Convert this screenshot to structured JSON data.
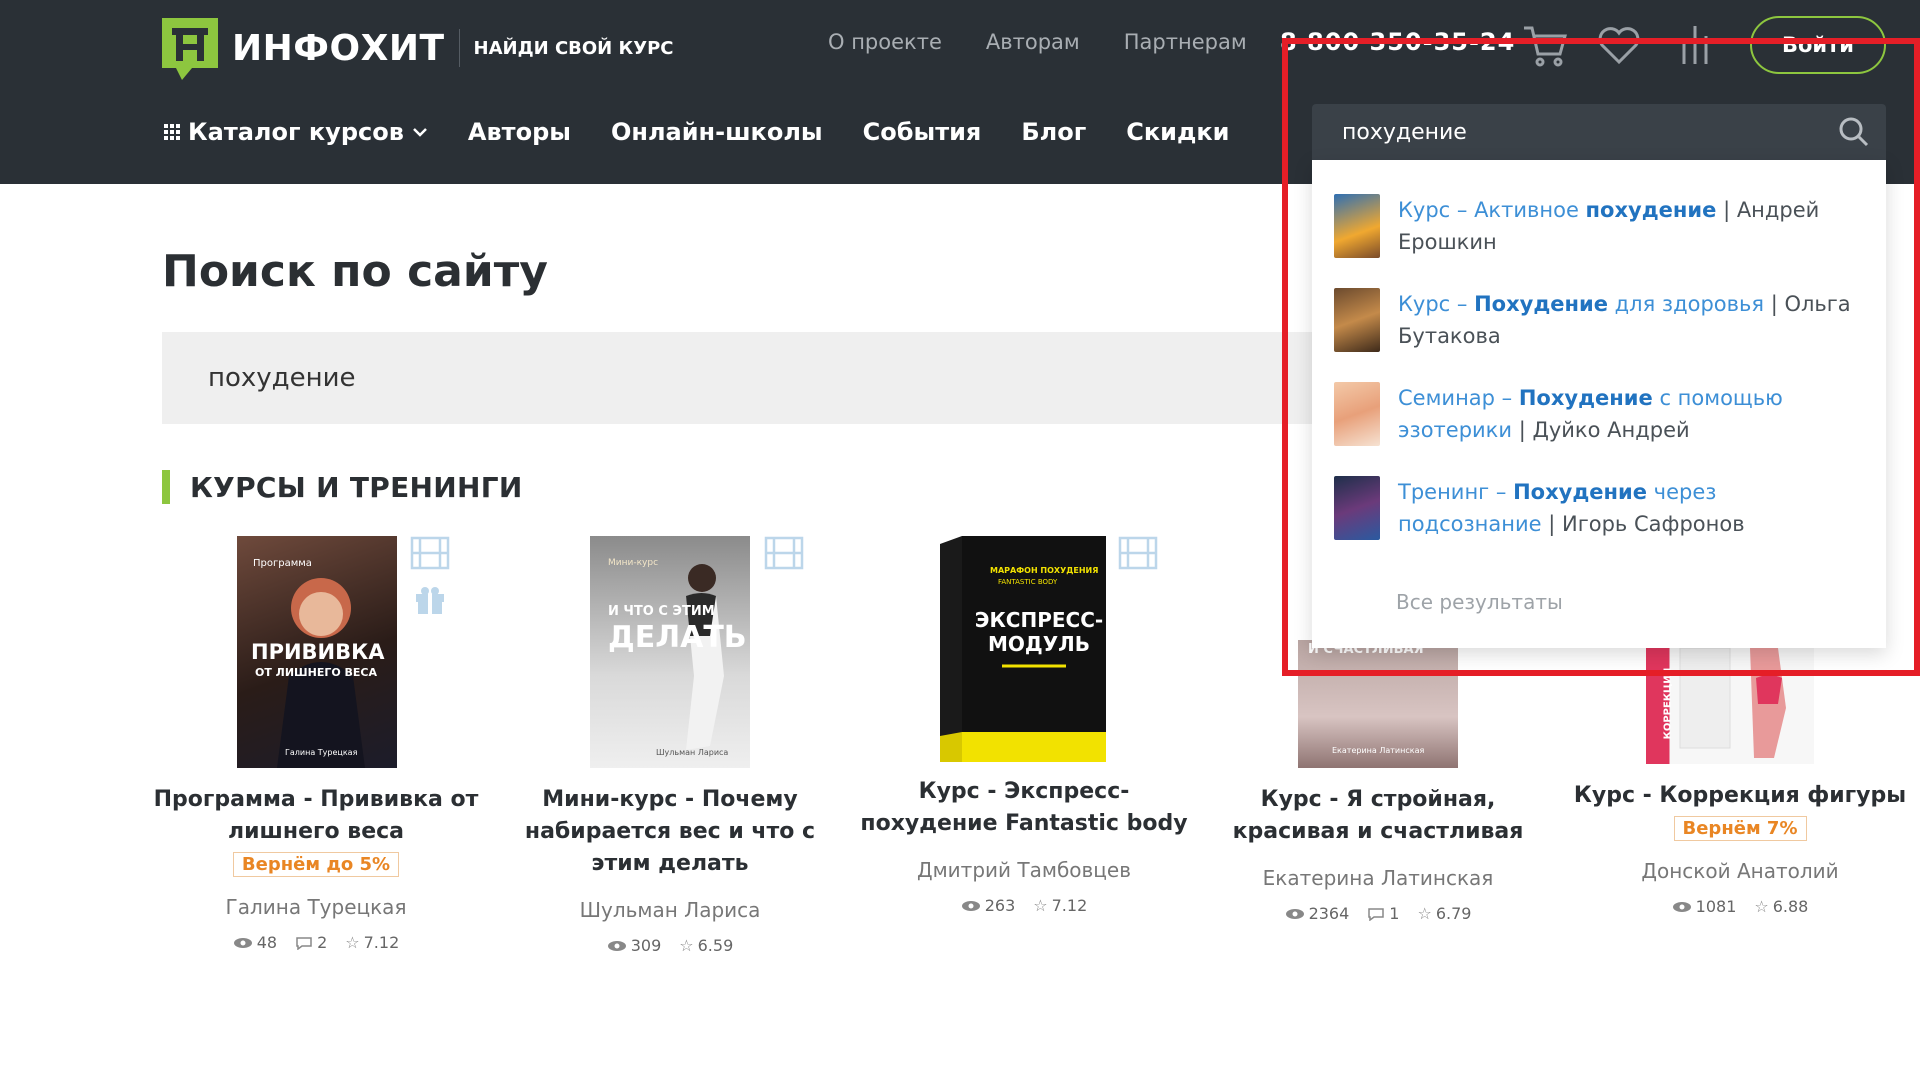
{
  "header": {
    "logo_name": "ИНФОХИТ",
    "logo_tagline": "НАЙДИ СВОЙ КУРС",
    "top_nav": [
      "О проекте",
      "Авторам",
      "Партнерам"
    ],
    "phone": "8 800 350-35-24",
    "login_label": "Войти",
    "main_nav": [
      "Каталог курсов",
      "Авторы",
      "Онлайн-школы",
      "События",
      "Блог",
      "Скидки"
    ]
  },
  "search_overlay": {
    "query": "похудение",
    "suggestions": [
      {
        "link_pre": "Курс – Активное ",
        "link_bold": "похудение",
        "link_post": "",
        "rest": " | Андрей Ерошкин"
      },
      {
        "link_pre": "Курс – ",
        "link_bold": "Похудение",
        "link_post": " для здоровья",
        "rest": " | Ольга Бутакова"
      },
      {
        "link_pre": "Семинар – ",
        "link_bold": "Похудение",
        "link_post": " с помощью эзотерики",
        "rest": " | Дуйко Андрей"
      },
      {
        "link_pre": "Тренинг – ",
        "link_bold": "Похудение",
        "link_post": " через подсознание",
        "rest": " | Игорь Сафронов"
      }
    ],
    "all_results_label": "Все результаты"
  },
  "page": {
    "title": "Поиск по сайту",
    "search_value": "похудение",
    "section_title": "КУРСЫ И ТРЕНИНГИ"
  },
  "cards": [
    {
      "title": "Программа - Прививка от лишнего веса",
      "cashback": "Вернём до 5%",
      "author": "Галина Турецкая",
      "views": "48",
      "comments": "2",
      "rating": "7.12",
      "cover_top": "Программа",
      "cover_main": "ПРИВИВКА",
      "cover_sub": "ОТ ЛИШНЕГО ВЕСА",
      "cover_author": "Галина Турецкая"
    },
    {
      "title": "Мини-курс - Почему набирается вес и что с этим делать",
      "cashback": "",
      "author": "Шульман Лариса",
      "views": "309",
      "comments": "",
      "rating": "6.59",
      "cover_top": "Мини-курс",
      "cover_main": "ДЕЛАТЬ",
      "cover_sub": "И ЧТО С ЭТИМ",
      "cover_author": "Шульман Лариса"
    },
    {
      "title": "Курс - Экспресс-похудение Fantastic body",
      "cashback": "",
      "author": "Дмитрий Тамбовцев",
      "views": "263",
      "comments": "",
      "rating": "7.12",
      "cover_top": "МАРАФОН ПОХУДЕНИЯ",
      "cover_main": "ЭКСПРЕСС-МОДУЛЬ",
      "cover_sub": "FANTASTIC BODY",
      "cover_author": ""
    },
    {
      "title": "Курс - Я стройная, красивая и счастливая",
      "cashback": "",
      "author": "Екатерина Латинская",
      "views": "2364",
      "comments": "1",
      "rating": "6.79",
      "cover_top": "",
      "cover_main": "И СЧАСТЛИВАЯ",
      "cover_sub": "",
      "cover_author": "Екатерина Латинская"
    },
    {
      "title": "Курс - Коррекция фигуры",
      "cashback": "Вернём 7%",
      "author": "Донской Анатолий",
      "views": "1081",
      "comments": "",
      "rating": "6.88",
      "cover_top": "",
      "cover_main": "КОРРЕКЦИЯ",
      "cover_sub": "",
      "cover_author": ""
    }
  ],
  "colors": {
    "header_bg": "#2a3036",
    "accent_green": "#8dc63f",
    "link_blue": "#3d8fd6",
    "highlight_red": "#e51e27",
    "cashback_orange": "#e98624"
  }
}
